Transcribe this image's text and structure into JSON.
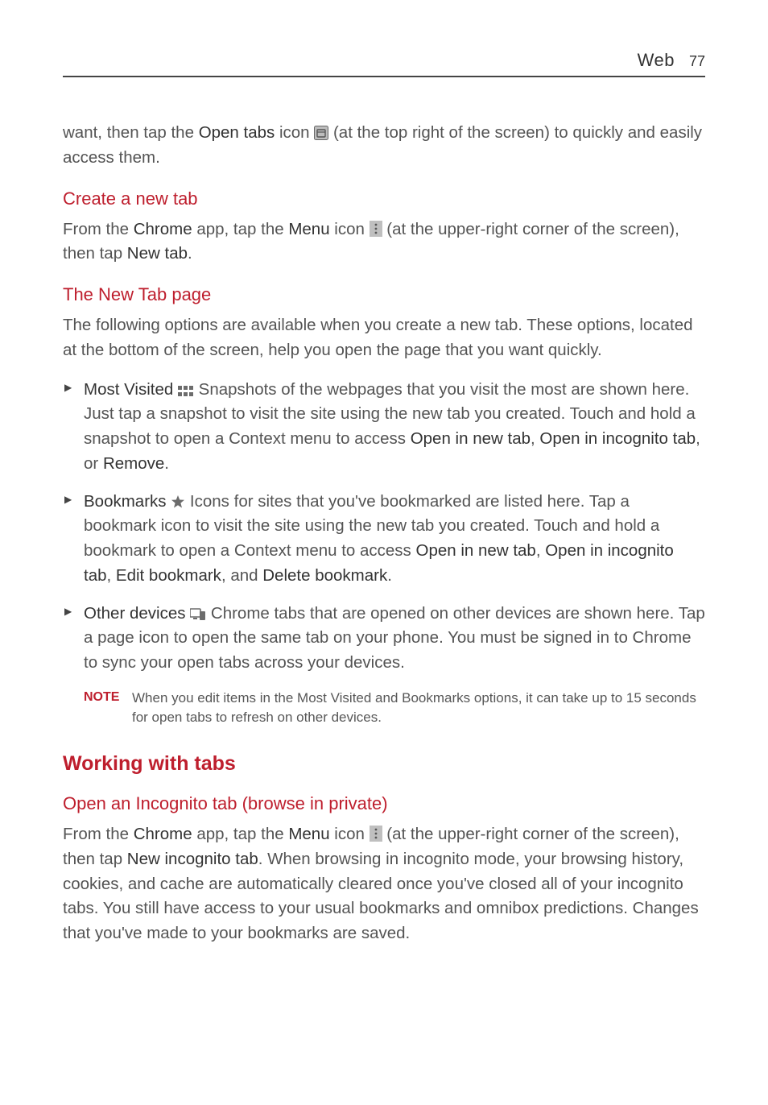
{
  "header": {
    "section": "Web",
    "page": "77"
  },
  "intro": {
    "pre": "want, then tap the ",
    "bold1": "Open tabs",
    "mid": " icon ",
    "post": " (at the top right of the screen) to quickly and easily access them."
  },
  "create": {
    "title": "Create a new tab",
    "p1_a": "From the ",
    "p1_chrome": "Chrome",
    "p1_b": " app, tap the ",
    "p1_menu": "Menu",
    "p1_c": " icon ",
    "p1_d": " (at the upper-right corner of the screen), then tap ",
    "p1_newtab": "New tab",
    "p1_e": "."
  },
  "newtab": {
    "title": "The New Tab page",
    "para": "The following options are available when you create a new tab. These options, located at the bottom of the screen, help you open the page that you want quickly.",
    "mv": {
      "label": "Most Visited",
      "text_a": " Snapshots of the webpages that you visit the most are shown here. Just tap a snapshot to visit the site using the new tab you created. Touch and hold a snapshot to open a Context menu to access ",
      "o1": "Open in new tab",
      "sep1": ", ",
      "o2": "Open in incognito tab",
      "sep2": ", or ",
      "o3": "Remove",
      "end": "."
    },
    "bm": {
      "label": "Bookmarks",
      "text_a": " Icons for sites that you've bookmarked are listed here. Tap a bookmark icon to visit the site using the new tab you created. Touch and hold a bookmark to open a Context menu to access ",
      "o1": "Open in new tab",
      "sep1": ", ",
      "o2": "Open in incognito tab",
      "sep2": ", ",
      "o3": "Edit bookmark",
      "sep3": ", and ",
      "o4": "Delete bookmark",
      "end": "."
    },
    "od": {
      "label": "Other devices",
      "text": " Chrome tabs that are opened on other devices are shown here. Tap a page icon to open the same tab on your phone. You must be signed in to Chrome to sync your open tabs across your devices."
    },
    "note": {
      "label": "NOTE",
      "text": "When you edit items in the Most Visited and Bookmarks options, it can take up to 15 seconds for open tabs to refresh on other devices."
    }
  },
  "working": {
    "title": "Working with tabs",
    "incog_title": "Open an Incognito tab (browse in private)",
    "p_a": "From the ",
    "p_chrome": "Chrome",
    "p_b": " app, tap the ",
    "p_menu": "Menu",
    "p_c": " icon ",
    "p_d": " (at the upper-right corner of the screen), then tap ",
    "p_nit": "New incognito tab",
    "p_e": ". When browsing in incognito mode, your browsing history, cookies, and cache are automatically cleared once you've closed all of your incognito tabs. You still have access to your usual bookmarks and omnibox predictions. Changes that you've made to your bookmarks are saved."
  }
}
